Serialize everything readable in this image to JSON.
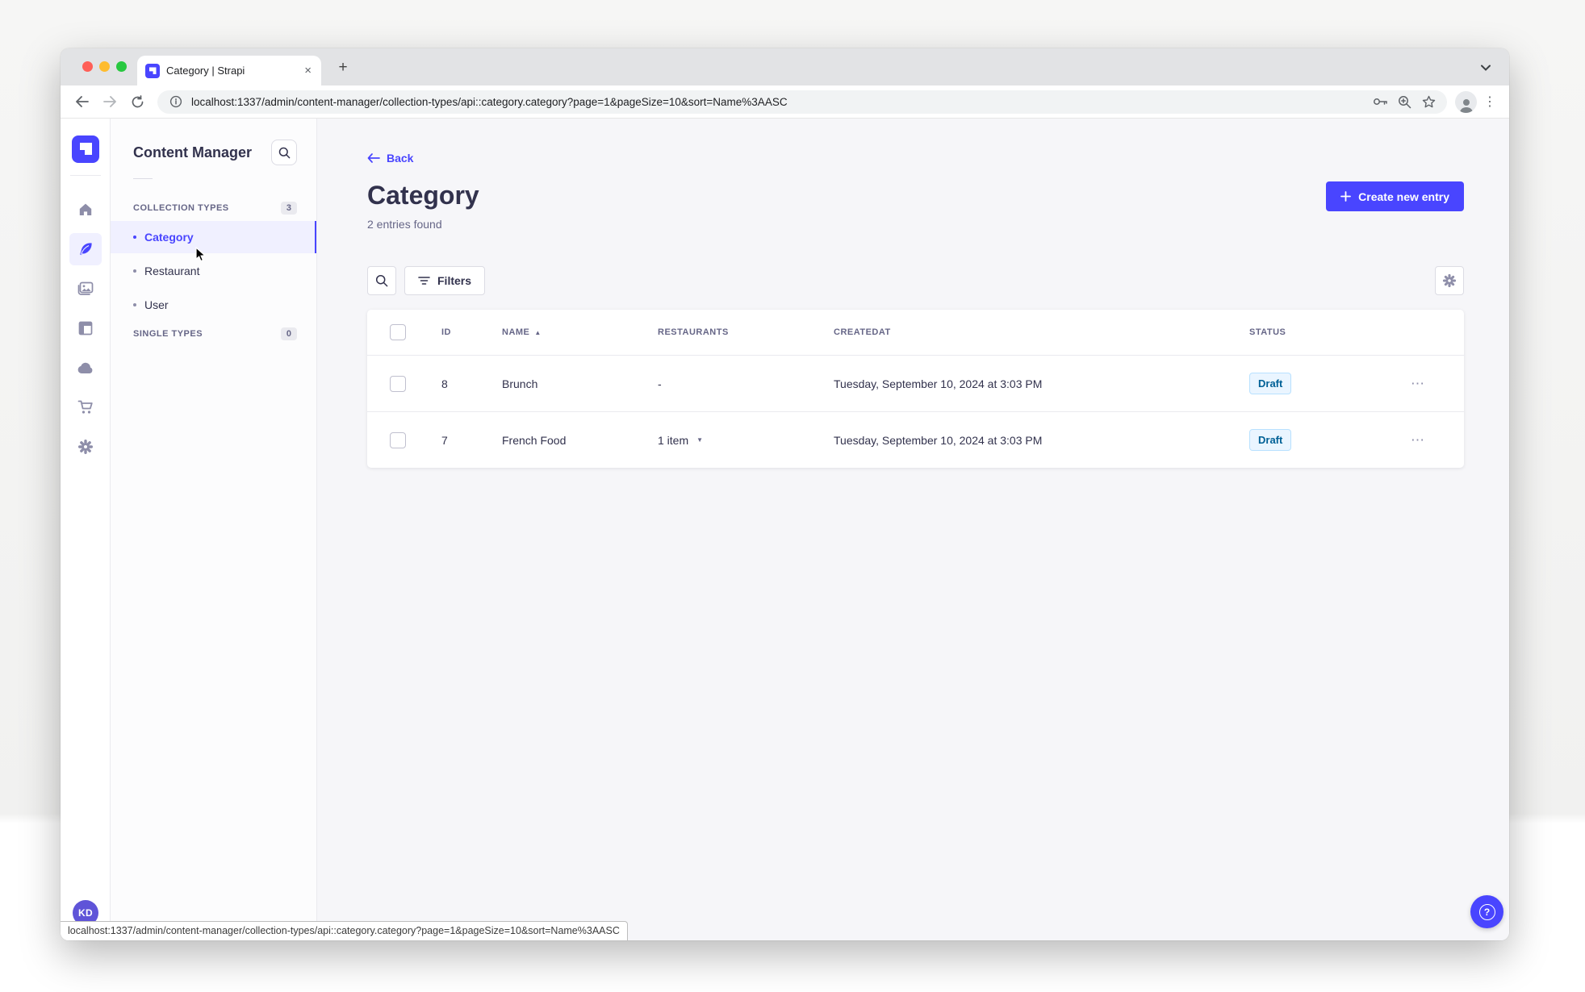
{
  "colors": {
    "primary": "#4945ff",
    "draft_bg": "#eaf5ff",
    "draft_border": "#b8e1ff",
    "draft_text": "#006096",
    "traffic_red": "#ff5f57",
    "traffic_yellow": "#febc2e",
    "traffic_green": "#28c840"
  },
  "browser": {
    "tab_title": "Category | Strapi",
    "url": "localhost:1337/admin/content-manager/collection-types/api::category.category?page=1&pageSize=10&sort=Name%3AASC",
    "close_tab": "×",
    "new_tab": "+"
  },
  "statusbar": {
    "link_preview": "localhost:1337/admin/content-manager/collection-types/api::category.category?page=1&pageSize=10&sort=Name%3AASC"
  },
  "nav": {
    "user_initials": "KD"
  },
  "subnav": {
    "title": "Content Manager",
    "sections": [
      {
        "label": "COLLECTION TYPES",
        "count": "3",
        "items": [
          {
            "label": "Category",
            "selected": true
          },
          {
            "label": "Restaurant",
            "selected": false
          },
          {
            "label": "User",
            "selected": false
          }
        ]
      },
      {
        "label": "SINGLE TYPES",
        "count": "0",
        "items": []
      }
    ]
  },
  "header": {
    "back_label": "Back",
    "title": "Category",
    "subtitle": "2 entries found",
    "create_button": "Create new entry"
  },
  "toolbar": {
    "filters_label": "Filters"
  },
  "table": {
    "columns": {
      "id": "ID",
      "name": "NAME",
      "restaurants": "RESTAURANTS",
      "createdat": "CREATEDAT",
      "status": "STATUS"
    },
    "rows": [
      {
        "id": "8",
        "name": "Brunch",
        "restaurants": "-",
        "created": "Tuesday, September 10, 2024 at 3:03 PM",
        "status": "Draft"
      },
      {
        "id": "7",
        "name": "French Food",
        "restaurants": "1 item",
        "created": "Tuesday, September 10, 2024 at 3:03 PM",
        "status": "Draft"
      }
    ]
  }
}
